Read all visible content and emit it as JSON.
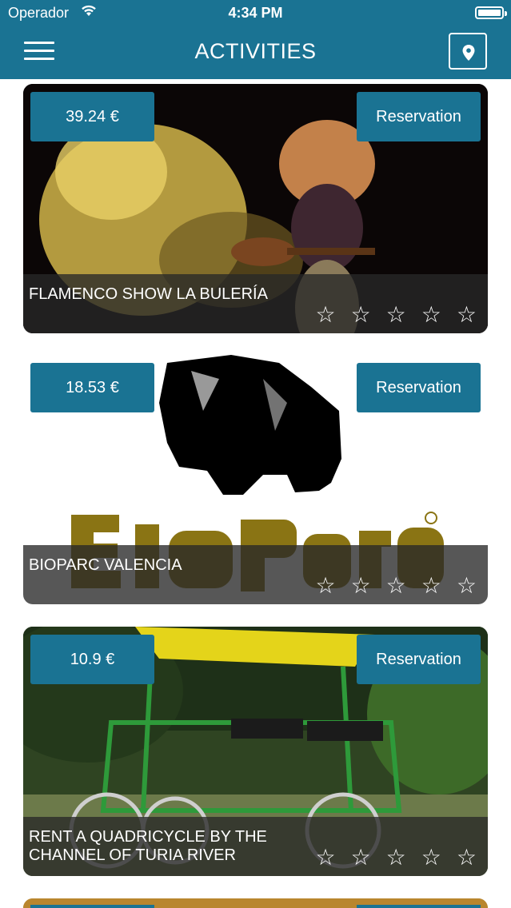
{
  "status_bar": {
    "carrier": "Operador",
    "time": "4:34 PM"
  },
  "header": {
    "title": "ACTIVITIES",
    "menu_icon": "hamburger-menu-icon",
    "map_icon": "map-pin-icon"
  },
  "activities": [
    {
      "price": "39.24 €",
      "reserve_label": "Reservation",
      "name": "FLAMENCO SHOW LA BULERÍA",
      "rating": 0,
      "max_rating": 5
    },
    {
      "price": "18.53 €",
      "reserve_label": "Reservation",
      "name": "BIOPARC VALENCIA",
      "rating": 0,
      "max_rating": 5,
      "logo_text": "BIOPARC"
    },
    {
      "price": "10.9 €",
      "reserve_label": "Reservation",
      "name": "RENT A QUADRICYCLE BY THE CHANNEL OF TURIA RIVER",
      "rating": 0,
      "max_rating": 5
    }
  ],
  "colors": {
    "accent": "#1a7393",
    "caption_overlay": "#282828"
  }
}
